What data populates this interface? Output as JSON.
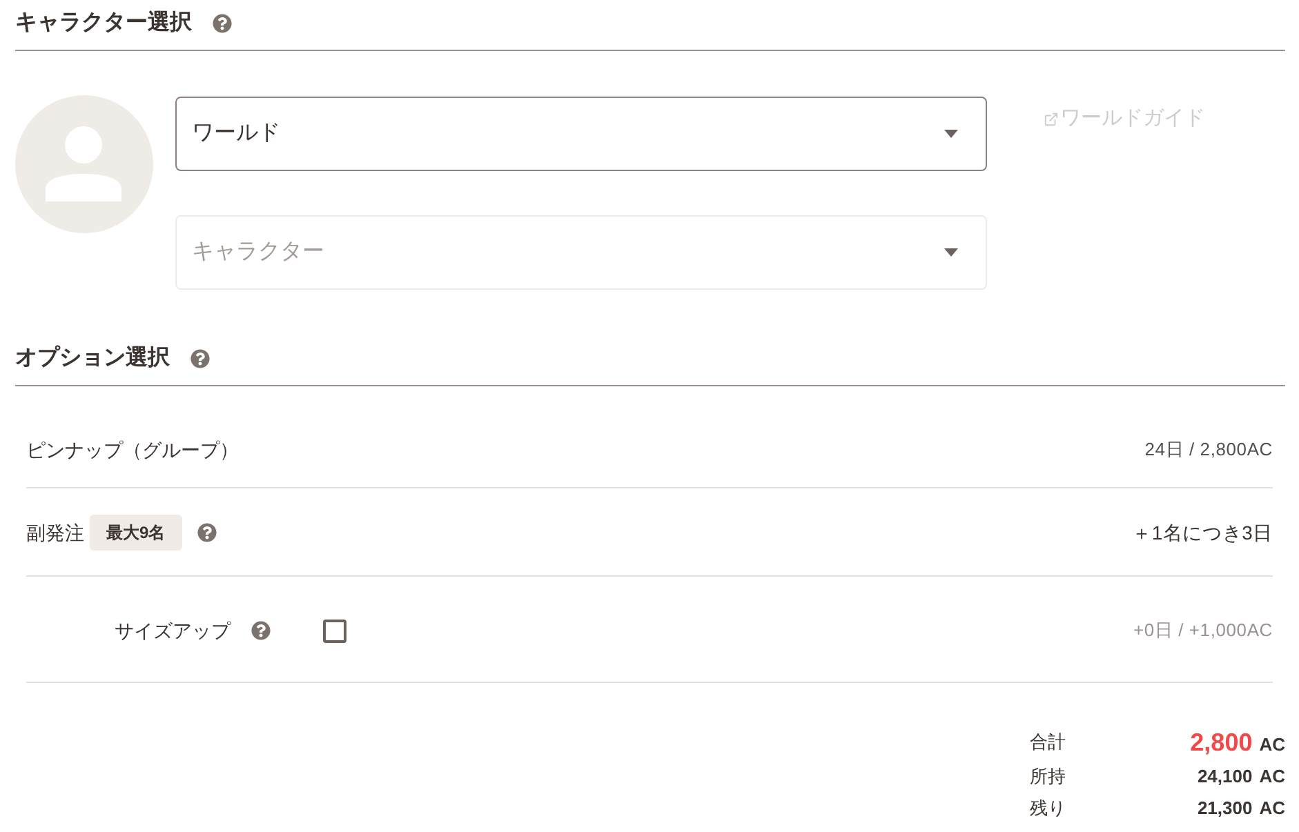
{
  "character_selection": {
    "title": "キャラクター選択",
    "world_select": {
      "value": "ワールド",
      "disabled": false
    },
    "character_select": {
      "placeholder": "キャラクター",
      "disabled": true
    },
    "world_guide_link": "ワールドガイド"
  },
  "option_selection": {
    "title": "オプション選択",
    "options": [
      {
        "kind": "plain",
        "label": "ピンナップ（グループ）",
        "help": false,
        "detail": "24日 / 2,800AC"
      },
      {
        "kind": "badge",
        "label": "副発注",
        "badge": "最大9名",
        "help": true,
        "detail": "＋1名につき3日"
      },
      {
        "kind": "checkbox",
        "label": "サイズアップ",
        "help": true,
        "checked": false,
        "detail": "+0日 / +1,000AC"
      }
    ]
  },
  "totals": [
    {
      "kind": "total",
      "label": "合計",
      "amount": "2,800",
      "unit": "AC"
    },
    {
      "kind": "balance",
      "label": "所持",
      "amount": "24,100",
      "unit": "AC"
    },
    {
      "kind": "balance",
      "label": "残り",
      "amount": "21,300",
      "unit": "AC"
    }
  ]
}
